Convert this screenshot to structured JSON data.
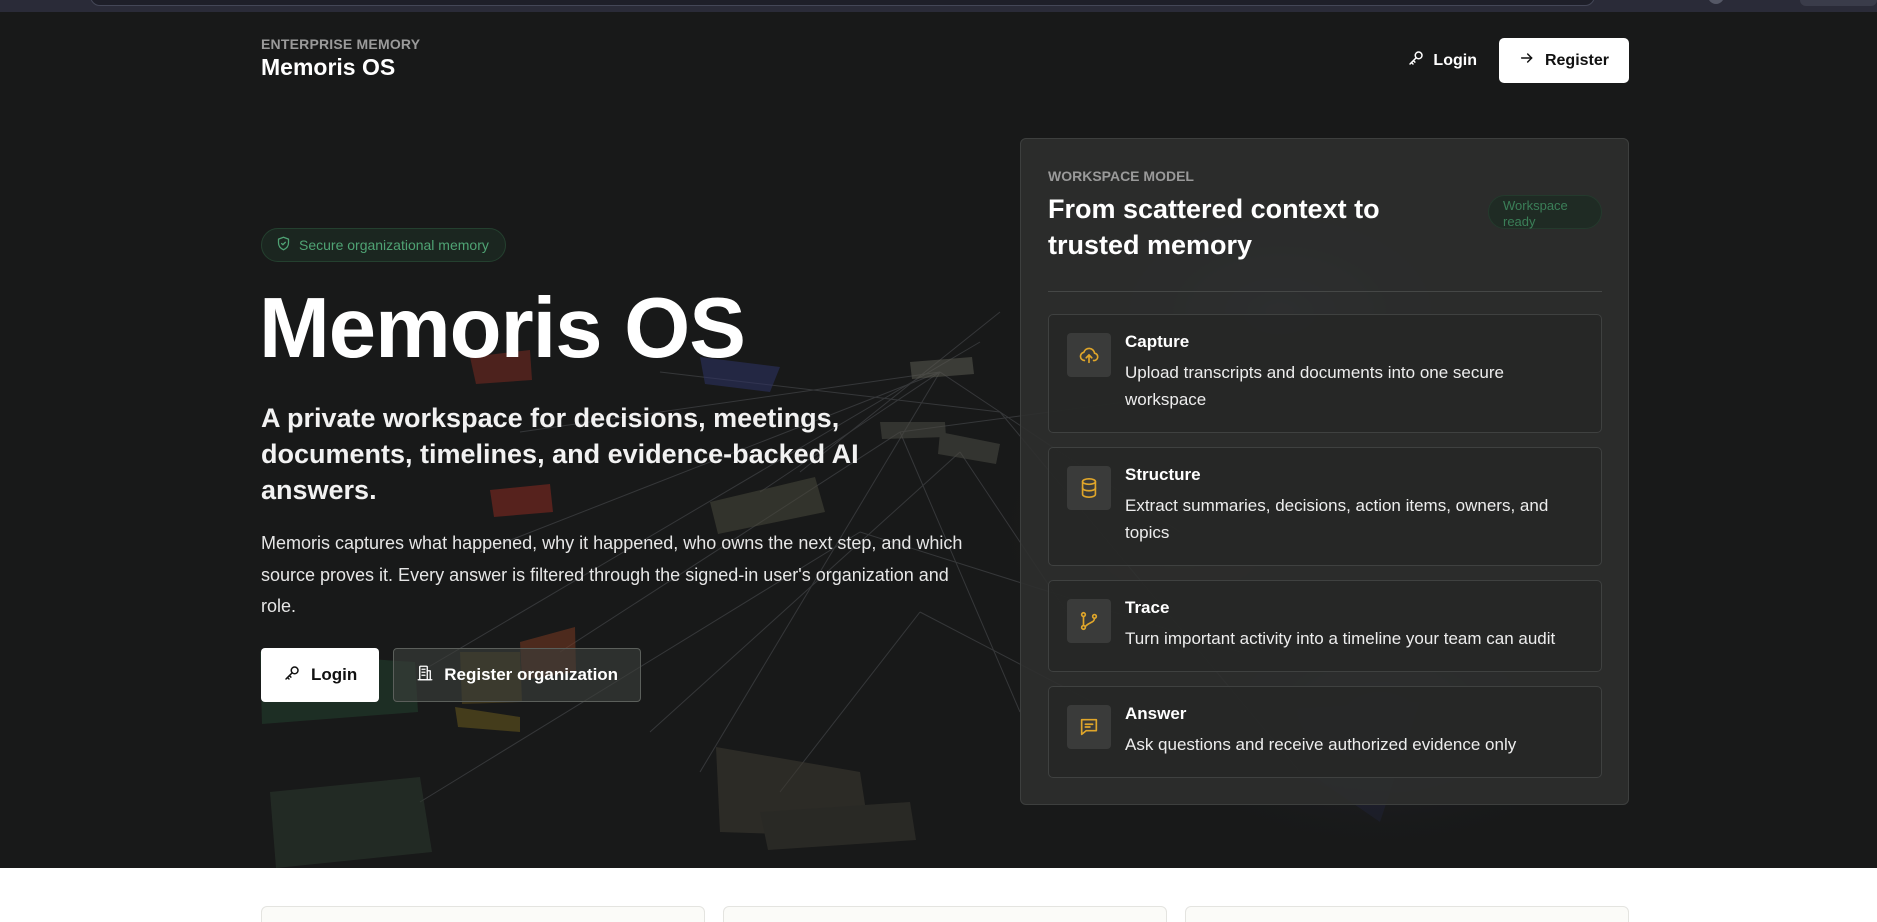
{
  "header": {
    "eyebrow": "ENTERPRISE MEMORY",
    "brand": "Memoris OS",
    "login_label": "Login",
    "register_label": "Register"
  },
  "hero": {
    "badge": "Secure organizational memory",
    "title": "Memoris OS",
    "subtitle": "A private workspace for decisions, meetings, documents, timelines, and evidence-backed AI answers.",
    "description": "Memoris captures what happened, why it happened, who owns the next step, and which source proves it. Every answer is filtered through the signed-in user's organization and role.",
    "login_label": "Login",
    "register_org_label": "Register organization"
  },
  "panel": {
    "eyebrow": "WORKSPACE MODEL",
    "title": "From scattered context to trusted memory",
    "status": "Workspace ready",
    "steps": [
      {
        "title": "Capture",
        "description": "Upload transcripts and documents into one secure workspace",
        "icon": "cloud-upload-icon"
      },
      {
        "title": "Structure",
        "description": "Extract summaries, decisions, action items, owners, and topics",
        "icon": "database-icon"
      },
      {
        "title": "Trace",
        "description": "Turn important activity into a timeline your team can audit",
        "icon": "git-branch-icon"
      },
      {
        "title": "Answer",
        "description": "Ask questions and receive authorized evidence only",
        "icon": "message-icon"
      }
    ]
  },
  "colors": {
    "accent_amber": "#e0a62a",
    "accent_green": "#4fa374",
    "background": "#181919"
  }
}
